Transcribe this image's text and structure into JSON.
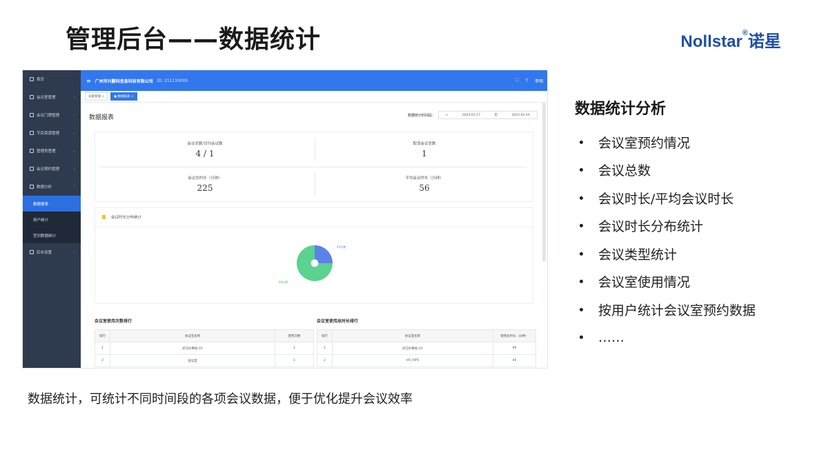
{
  "slide": {
    "title": "管理后台——数据统计",
    "brand_name": "Nollstar",
    "brand_mark": "®",
    "brand_cn": "诺星",
    "caption": "数据统计，可统计不同时间段的各项会议数据，便于优化提升会议效率"
  },
  "sidebar": {
    "items": [
      {
        "label": "首页"
      },
      {
        "label": "会议室管理"
      },
      {
        "label": "会议门牌管理"
      },
      {
        "label": "节目资源管理"
      },
      {
        "label": "管理员管理"
      },
      {
        "label": "会议预约管理"
      },
      {
        "label": "数据分析"
      }
    ],
    "sub_items": [
      {
        "label": "数据报表"
      },
      {
        "label": "用户统计"
      },
      {
        "label": "签到数据统计"
      }
    ],
    "last_item": {
      "label": "后台设置"
    }
  },
  "topbar": {
    "menu_icon": "≡",
    "company": "广州市兴鹏科信息科技有限公司",
    "id_text": "ID: 211110005",
    "user": "李明"
  },
  "tabs": [
    {
      "label": "设备管理 ×"
    },
    {
      "label": "● 数据报表 ×"
    }
  ],
  "content": {
    "page_title": "数据报表",
    "range_label": "数据统计时间段：",
    "range_start": "2023-01-17",
    "range_sep": "至",
    "range_end": "2023-02-16"
  },
  "stats": [
    {
      "label": "会议总数/日均会议数",
      "value": "4 / 1"
    },
    {
      "label": "取消会议总数",
      "value": "1"
    },
    {
      "label": "会议总时长（分钟）",
      "value": "225"
    },
    {
      "label": "平均会议时长（分钟）",
      "value": "56"
    }
  ],
  "distribution": {
    "title": "会议时长分布统计",
    "label_a": "45分钟",
    "label_b": "90分钟",
    "fraction_a": 0.25,
    "color_a": "#5b82e8",
    "color_b": "#5bd28f"
  },
  "ranking_count": {
    "title": "会议室使用次数排行",
    "headers": [
      "排行",
      "会议室名称",
      "使用次数"
    ],
    "rows": [
      [
        "1",
        "武汉办事处-01",
        "1"
      ],
      [
        "2",
        "会议室",
        "1"
      ]
    ]
  },
  "ranking_duration": {
    "title": "会议室使用总时长排行",
    "headers": [
      "排行",
      "会议室名称",
      "使用总时长（分钟）"
    ],
    "rows": [
      [
        "1",
        "武汉办事处-01",
        "90"
      ],
      [
        "2",
        "VIC-VIP5",
        "40"
      ]
    ]
  },
  "features": {
    "title": "数据统计分析",
    "items": [
      "会议室预约情况",
      "会议总数",
      "会议时长/平均会议时长",
      "会议时长分布统计",
      "会议类型统计",
      "会议室使用情况",
      "按用户统计会议室预约数据",
      "……"
    ]
  }
}
